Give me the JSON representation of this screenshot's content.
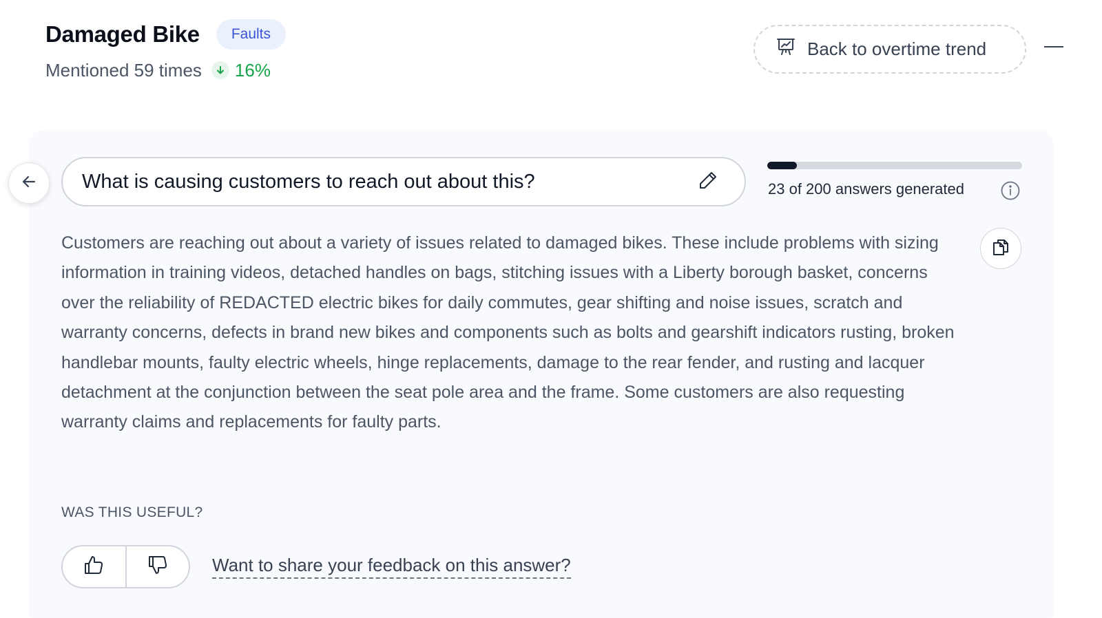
{
  "header": {
    "title": "Damaged Bike",
    "tag": "Faults",
    "mentioned": "Mentioned 59 times",
    "trend_value": "16%",
    "trend_direction": "down",
    "trend_color": "#16a34a",
    "back_button_label": "Back to overtime trend"
  },
  "question": {
    "text": "What is causing customers to reach out about this?"
  },
  "progress": {
    "generated": 23,
    "total": 200,
    "label": "23 of 200 answers generated"
  },
  "answer": {
    "text": "Customers are reaching out about a variety of issues related to damaged bikes. These include problems with sizing information in training videos, detached handles on bags, stitching issues with a Liberty borough basket, concerns over the reliability of REDACTED electric bikes for daily commutes, gear shifting and noise issues, scratch and warranty concerns, defects in brand new bikes and components such as bolts and gearshift indicators rusting, broken handlebar mounts, faulty electric wheels, hinge replacements, damage to the rear fender, and rusting and lacquer detachment at the conjunction between the seat pole area and the frame. Some customers are also requesting warranty claims and replacements for faulty parts."
  },
  "feedback": {
    "useful_label": "WAS THIS USEFUL?",
    "link_text": "Want to share your feedback on this answer?"
  },
  "icons": {
    "trend": "arrow-down-icon",
    "back_trend": "presentation-chart-icon",
    "back": "arrow-left-icon",
    "edit": "pencil-icon",
    "info": "info-icon",
    "copy": "copy-icon",
    "thumbs_up": "thumbs-up-icon",
    "thumbs_down": "thumbs-down-icon"
  }
}
